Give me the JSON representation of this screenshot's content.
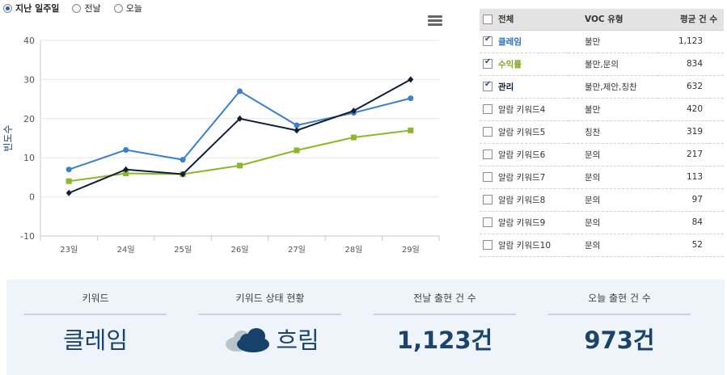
{
  "period_options": [
    {
      "label": "지난 일주일",
      "selected": true
    },
    {
      "label": "전날",
      "selected": false
    },
    {
      "label": "오늘",
      "selected": false
    }
  ],
  "chart_data": {
    "type": "line",
    "categories": [
      "23일",
      "24일",
      "25일",
      "26일",
      "27일",
      "28일",
      "29일"
    ],
    "ylabel": "빈도수",
    "ylim": [
      -10,
      40
    ],
    "yticks": [
      -10,
      0,
      10,
      20,
      30,
      40
    ],
    "grid": true,
    "series": [
      {
        "name": "클레임",
        "color": "#3a7fd0",
        "marker": "circle",
        "values": [
          7,
          12,
          9.5,
          27,
          18.3,
          21.5,
          25.2
        ]
      },
      {
        "name": "수익률",
        "color": "#8ab82a",
        "marker": "square",
        "values": [
          4,
          6,
          5.8,
          8,
          11.9,
          15.2,
          17
        ]
      },
      {
        "name": "관리",
        "color": "#0e2038",
        "marker": "diamond",
        "values": [
          1,
          7,
          5.8,
          20,
          17,
          22,
          30
        ]
      }
    ]
  },
  "table": {
    "headers": {
      "all": "전체",
      "type": "VOC 유형",
      "avg": "평균 건 수"
    },
    "rows": [
      {
        "keyword": "클레임",
        "type": "불만",
        "count": "1,123",
        "checked": true,
        "color": "#2a6fc0"
      },
      {
        "keyword": "수익률",
        "type": "불만,문의",
        "count": "834",
        "checked": true,
        "color": "#7aa81e"
      },
      {
        "keyword": "관리",
        "type": "불만,제안,칭찬",
        "count": "632",
        "checked": true,
        "color": "#0e2038"
      },
      {
        "keyword": "알람 키워드4",
        "type": "불만",
        "count": "420",
        "checked": false,
        "color": ""
      },
      {
        "keyword": "알람 키워드5",
        "type": "칭찬",
        "count": "319",
        "checked": false,
        "color": ""
      },
      {
        "keyword": "알람 키워드6",
        "type": "문의",
        "count": "217",
        "checked": false,
        "color": ""
      },
      {
        "keyword": "알람 키워드7",
        "type": "문의",
        "count": "113",
        "checked": false,
        "color": ""
      },
      {
        "keyword": "알람 키워드8",
        "type": "문의",
        "count": "97",
        "checked": false,
        "color": ""
      },
      {
        "keyword": "알람 키워드9",
        "type": "문의",
        "count": "84",
        "checked": false,
        "color": ""
      },
      {
        "keyword": "알람 키워드10",
        "type": "문의",
        "count": "52",
        "checked": false,
        "color": ""
      }
    ]
  },
  "summary": {
    "keyword_label": "키워드",
    "keyword_value": "클레임",
    "status_label": "키워드 상태 현황",
    "status_value": "흐림",
    "status_icon": "cloud-icon",
    "yesterday_label": "전날 출현 건 수",
    "yesterday_value": "1,123건",
    "today_label": "오늘 출현 건 수",
    "today_value": "973건"
  }
}
